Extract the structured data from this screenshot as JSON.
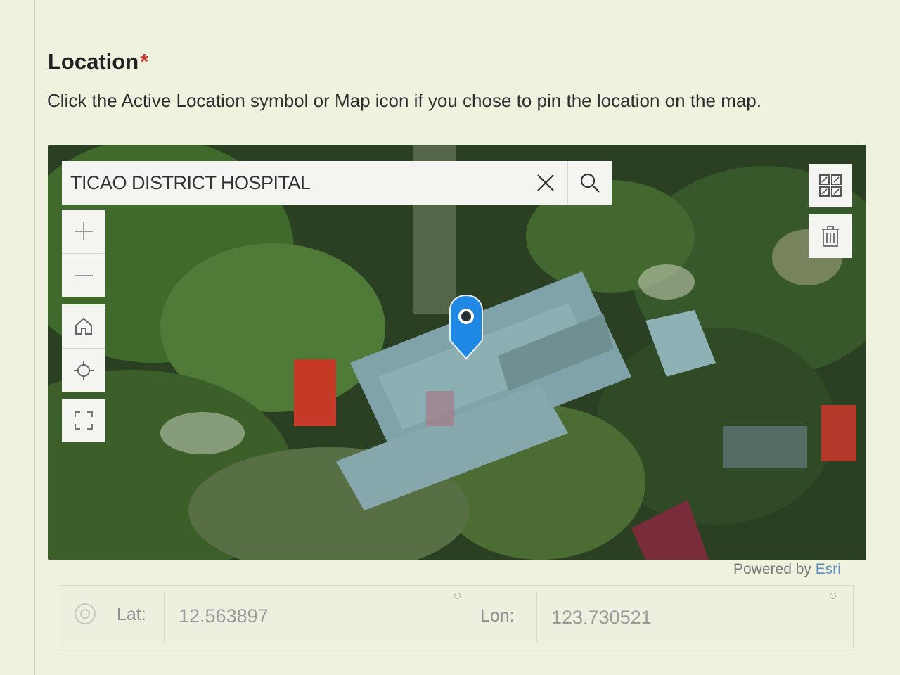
{
  "field": {
    "title": "Location",
    "required_marker": "*",
    "hint": "Click the Active Location symbol or Map icon if you chose to pin the location on the map."
  },
  "map": {
    "search": {
      "value": "TICAO DISTRICT HOSPITAL",
      "clear_icon": "close-icon",
      "search_icon": "search-icon"
    },
    "controls": {
      "zoom_in_icon": "plus-icon",
      "zoom_out_icon": "minus-icon",
      "home_icon": "home-icon",
      "locate_icon": "crosshair-icon",
      "fullscreen_icon": "expand-icon",
      "basemap_icon": "basemap-gallery-icon",
      "delete_icon": "trash-icon"
    },
    "marker_icon": "map-pin-icon",
    "marker_color": "#1f88e5",
    "attribution_prefix": "Powered by ",
    "attribution_brand": "Esri"
  },
  "coordinates": {
    "lat_label": "Lat:",
    "lat_value": "12.563897",
    "lon_label": "Lon:",
    "lon_value": "123.730521"
  },
  "colors": {
    "required": "#c6342a",
    "page_background": "#eef2de"
  }
}
